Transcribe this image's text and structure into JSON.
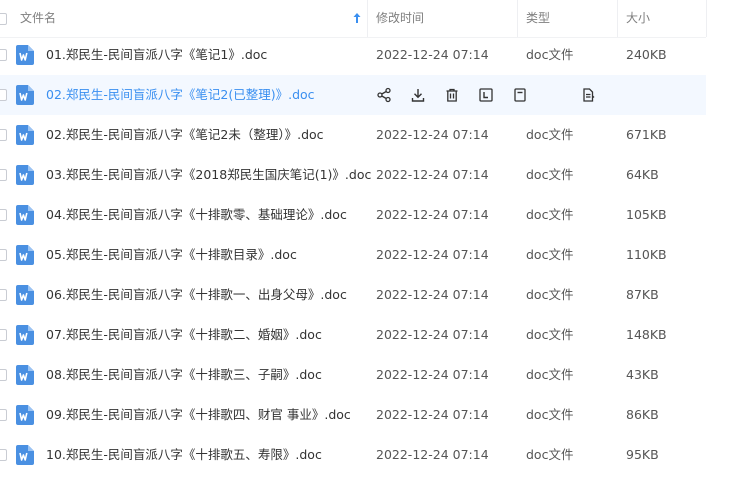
{
  "header": {
    "name": "文件名",
    "modified": "修改时间",
    "type": "类型",
    "size": "大小"
  },
  "files": [
    {
      "name": "01.郑民生-民间盲派八字《笔记1》.doc",
      "modified": "2022-12-24 07:14",
      "type": "doc文件",
      "size": "240KB"
    },
    {
      "name": "02.郑民生-民间盲派八字《笔记2(已整理)》.doc",
      "modified": "",
      "type": "",
      "size": ""
    },
    {
      "name": "02.郑民生-民间盲派八字《笔记2未（整理）》.doc",
      "modified": "2022-12-24 07:14",
      "type": "doc文件",
      "size": "671KB"
    },
    {
      "name": "03.郑民生-民间盲派八字《2018郑民生国庆笔记(1)》.doc",
      "modified": "2022-12-24 07:14",
      "type": "doc文件",
      "size": "64KB"
    },
    {
      "name": "04.郑民生-民间盲派八字《十排歌零、基础理论》.doc",
      "modified": "2022-12-24 07:14",
      "type": "doc文件",
      "size": "105KB"
    },
    {
      "name": "05.郑民生-民间盲派八字《十排歌目录》.doc",
      "modified": "2022-12-24 07:14",
      "type": "doc文件",
      "size": "110KB"
    },
    {
      "name": "06.郑民生-民间盲派八字《十排歌一、出身父母》.doc",
      "modified": "2022-12-24 07:14",
      "type": "doc文件",
      "size": "87KB"
    },
    {
      "name": "07.郑民生-民间盲派八字《十排歌二、婚姻》.doc",
      "modified": "2022-12-24 07:14",
      "type": "doc文件",
      "size": "148KB"
    },
    {
      "name": "08.郑民生-民间盲派八字《十排歌三、子嗣》.doc",
      "modified": "2022-12-24 07:14",
      "type": "doc文件",
      "size": "43KB"
    },
    {
      "name": "09.郑民生-民间盲派八字《十排歌四、财官 事业》.doc",
      "modified": "2022-12-24 07:14",
      "type": "doc文件",
      "size": "86KB"
    },
    {
      "name": "10.郑民生-民间盲派八字《十排歌五、寿限》.doc",
      "modified": "2022-12-24 07:14",
      "type": "doc文件",
      "size": "95KB"
    }
  ],
  "row_actions": [
    "share-icon",
    "download-icon",
    "delete-icon",
    "rename-icon",
    "move-icon",
    "copy-icon"
  ],
  "colors": {
    "accent": "#3a8ff0",
    "hover_row": "#f3f8ff",
    "word_icon": "#4a90e2"
  }
}
